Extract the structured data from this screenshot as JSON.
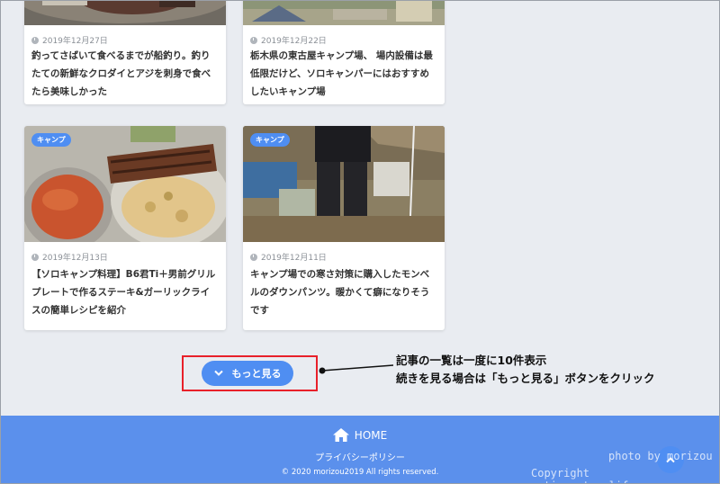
{
  "cards": [
    {
      "date": "2019年12月27日",
      "title": "釣ってさばいて食べるまでが船釣り。釣りたての新鮮なクロダイとアジを刺身で食べたら美味しかった"
    },
    {
      "date": "2019年12月22日",
      "title": "栃木県の東古屋キャンプ場、 場内設備は最低限だけど、ソロキャンパーにはおすすめしたいキャンプ場"
    },
    {
      "badge": "キャンプ",
      "date": "2019年12月13日",
      "title": "【ソロキャンプ料理】B6君Ti＋男前グリルプレートで作るステーキ&ガーリックライスの簡単レシピを紹介"
    },
    {
      "badge": "キャンプ",
      "date": "2019年12月11日",
      "title": "キャンプ場での寒さ対策に購入したモンベルのダウンパンツ。暖かくて癖になりそうです"
    }
  ],
  "more_button": {
    "label": "もっと見る",
    "icon": "chevron-down-icon"
  },
  "annotation": {
    "line1": "記事の一覧は一度に10件表示",
    "line2": "続きを見る場合は「もっと見る」ボタンをクリック"
  },
  "footer": {
    "home_label": "HOME",
    "home_icon": "home-icon",
    "privacy": "プライバシーポリシー",
    "copyright": "© 2020 morizou2019 All rights reserved."
  },
  "watermark": {
    "line1": "photo by morizou",
    "line2": "Copyright activenaturelife.com"
  },
  "colors": {
    "accent": "#4f8ef2",
    "footer_bg": "#5b90ec",
    "page_bg": "#e9ecf1",
    "highlight": "#e8202a"
  }
}
